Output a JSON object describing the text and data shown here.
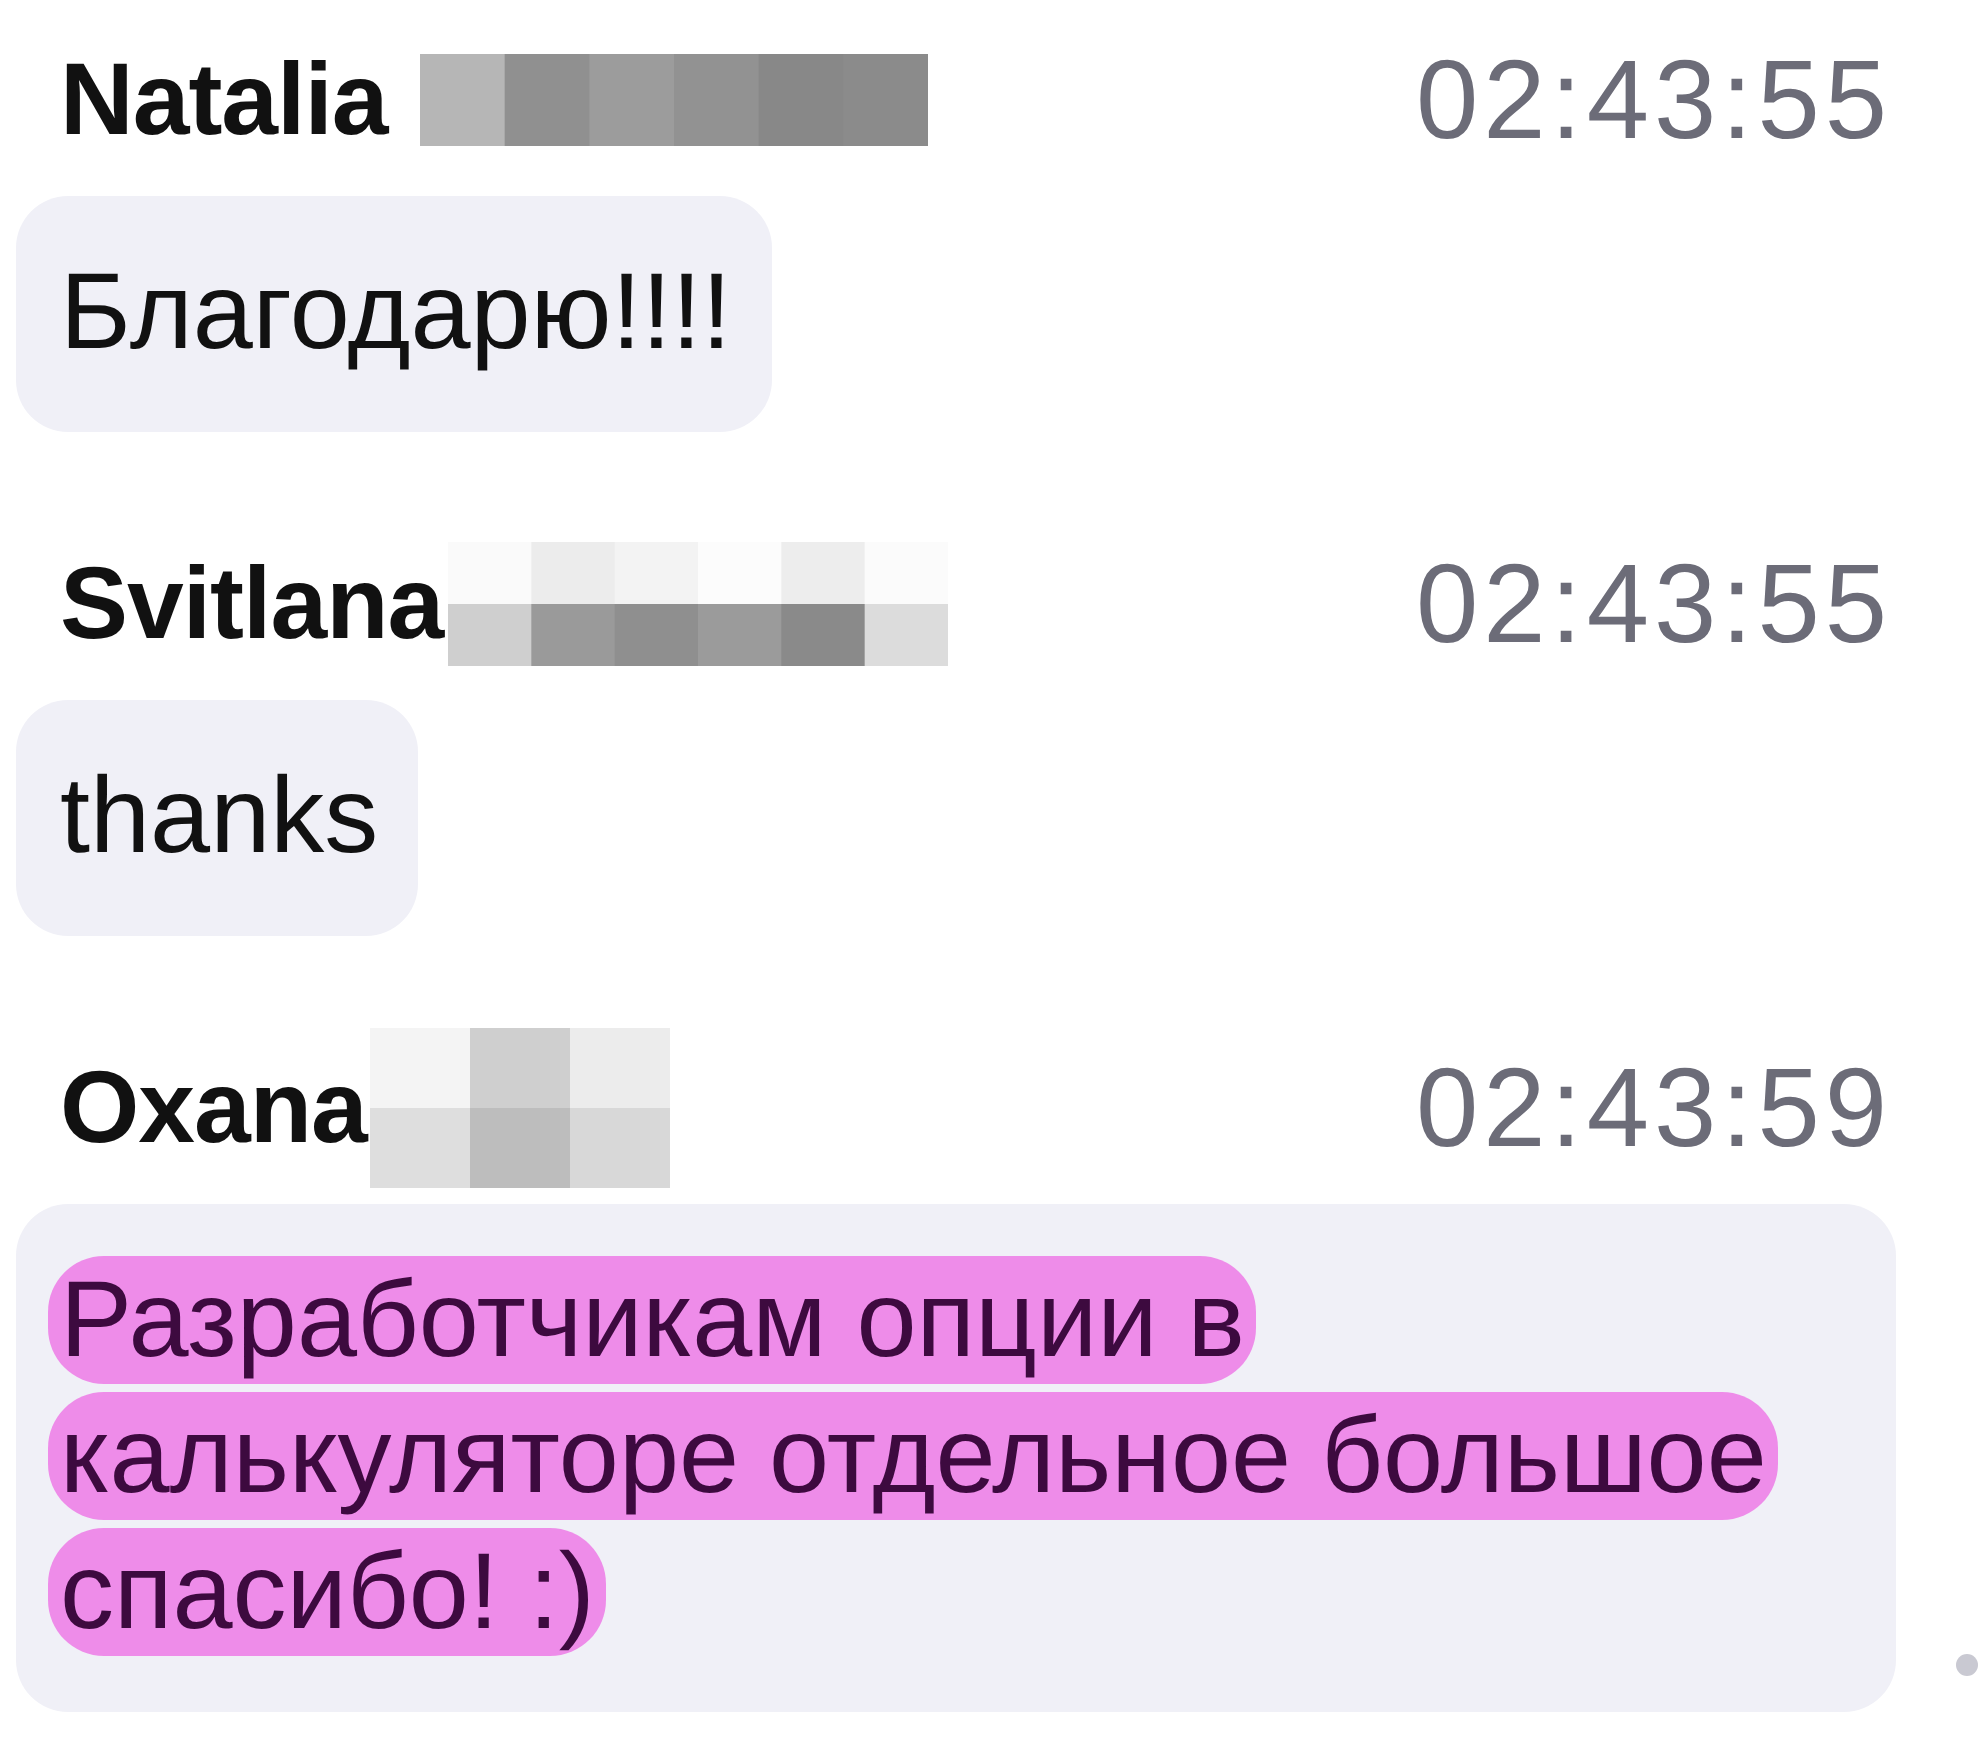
{
  "messages": [
    {
      "sender": "Natalia",
      "surname_redacted": true,
      "time": "02:43:55",
      "text": "Благодарю!!!!",
      "highlighted": false
    },
    {
      "sender": "Svitlana",
      "surname_redacted": true,
      "time": "02:43:55",
      "text": "thanks",
      "highlighted": false
    },
    {
      "sender": "Oxana",
      "surname_redacted": true,
      "time": "02:43:59",
      "text": "Разработчикам опции в калькуляторе отдельное большое спасибо! :)",
      "highlighted": true
    }
  ]
}
